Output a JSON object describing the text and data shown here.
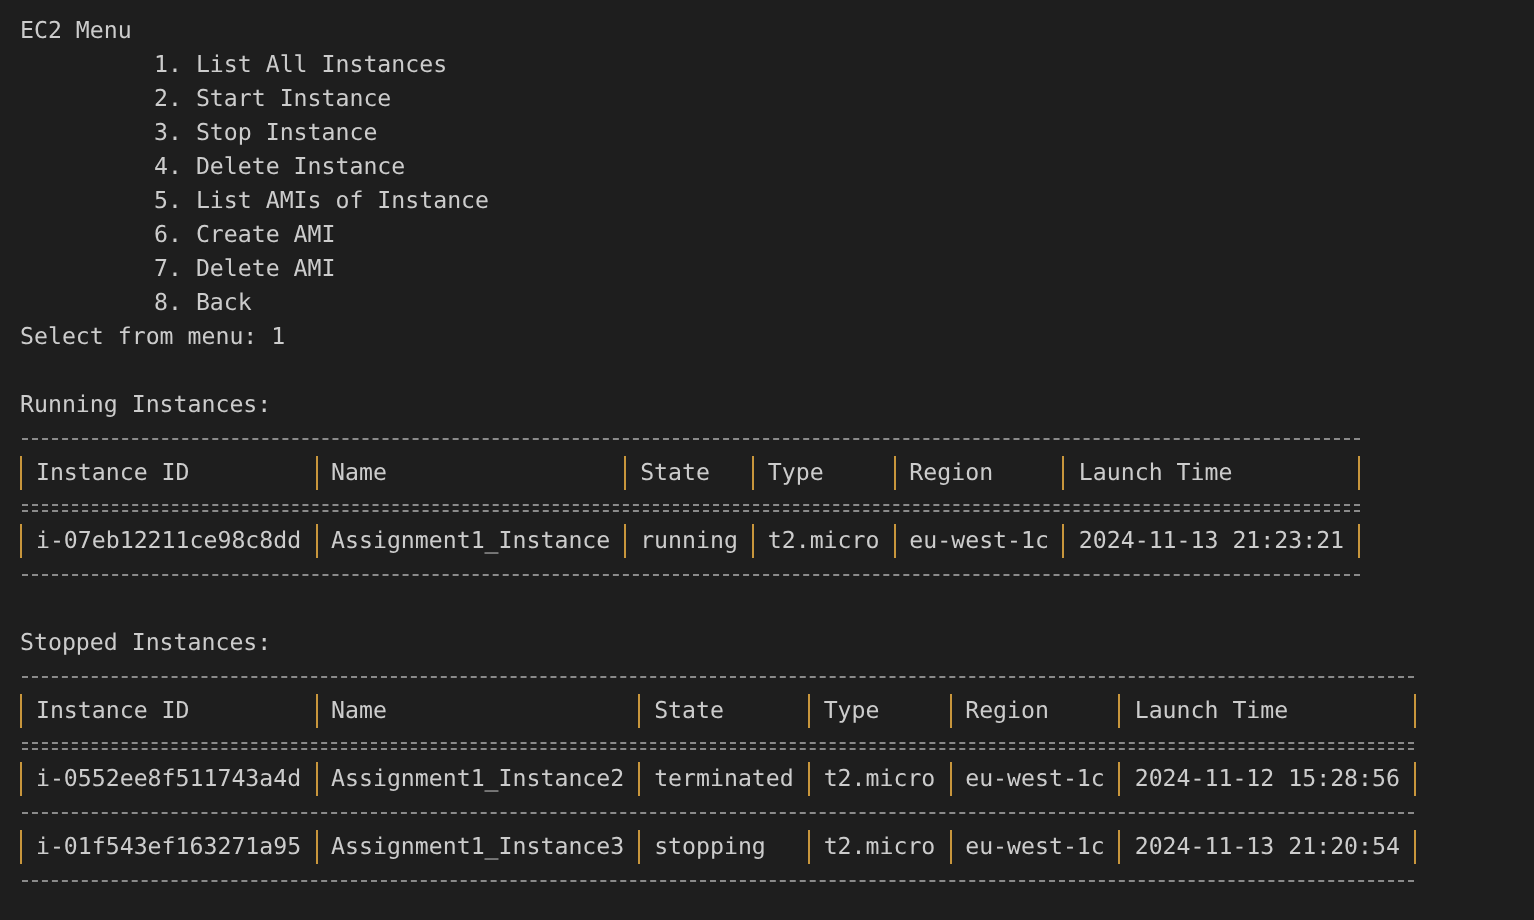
{
  "menu": {
    "title": "EC2 Menu",
    "items": [
      "1. List All Instances",
      "2. Start Instance",
      "3. Stop Instance",
      "4. Delete Instance",
      "5. List AMIs of Instance",
      "6. Create AMI",
      "7. Delete AMI",
      "8. Back"
    ]
  },
  "prompt": {
    "label": "Select from menu:",
    "value": "1"
  },
  "tables": [
    {
      "title": "Running Instances:",
      "columns": [
        "Instance ID",
        "Name",
        "State",
        "Type",
        "Region",
        "Launch Time"
      ],
      "rows": [
        [
          "i-07eb12211ce98c8dd",
          "Assignment1_Instance",
          "running",
          "t2.micro",
          "eu-west-1c",
          "2024-11-13 21:23:21"
        ]
      ]
    },
    {
      "title": "Stopped Instances:",
      "columns": [
        "Instance ID",
        "Name",
        "State",
        "Type",
        "Region",
        "Launch Time"
      ],
      "rows": [
        [
          "i-0552ee8f511743a4d",
          "Assignment1_Instance2",
          "terminated",
          "t2.micro",
          "eu-west-1c",
          "2024-11-12 15:28:56"
        ],
        [
          "i-01f543ef163271a95",
          "Assignment1_Instance3",
          "stopping",
          "t2.micro",
          "eu-west-1c",
          "2024-11-13 21:20:54"
        ]
      ]
    }
  ]
}
